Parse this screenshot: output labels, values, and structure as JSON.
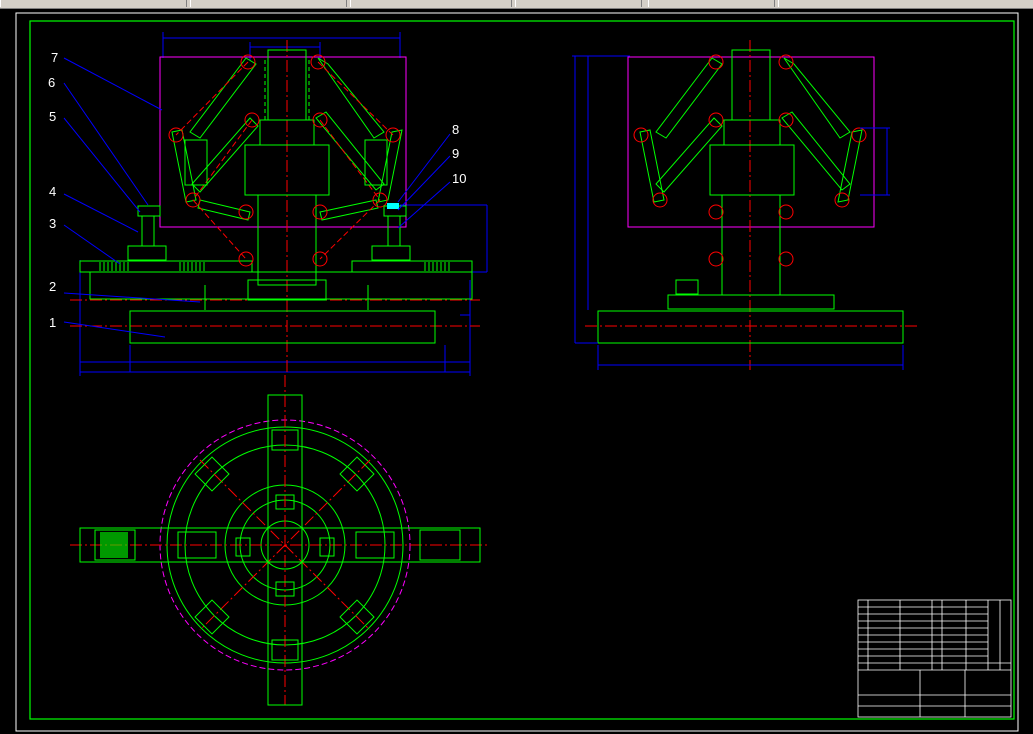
{
  "app": {
    "toolbar_segments": 7
  },
  "colors": {
    "background": "#000000",
    "frame": "#00ff00",
    "outline": "#00ff00",
    "centerline": "#ff0000",
    "hidden": "#ff00ff",
    "dimension": "#0000ff",
    "leader": "#0000ff",
    "balloon_text": "#ffffff",
    "title_block": "#ffffff"
  },
  "balloons": [
    {
      "id": "1",
      "label": "1"
    },
    {
      "id": "2",
      "label": "2"
    },
    {
      "id": "3",
      "label": "3"
    },
    {
      "id": "4",
      "label": "4"
    },
    {
      "id": "5",
      "label": "5"
    },
    {
      "id": "6",
      "label": "6"
    },
    {
      "id": "7",
      "label": "7"
    },
    {
      "id": "8",
      "label": "8"
    },
    {
      "id": "9",
      "label": "9"
    },
    {
      "id": "10",
      "label": "10"
    }
  ],
  "views": {
    "front": "front-view",
    "side": "side-view",
    "plan": "plan-view"
  },
  "title_block": {
    "rows": 10
  }
}
